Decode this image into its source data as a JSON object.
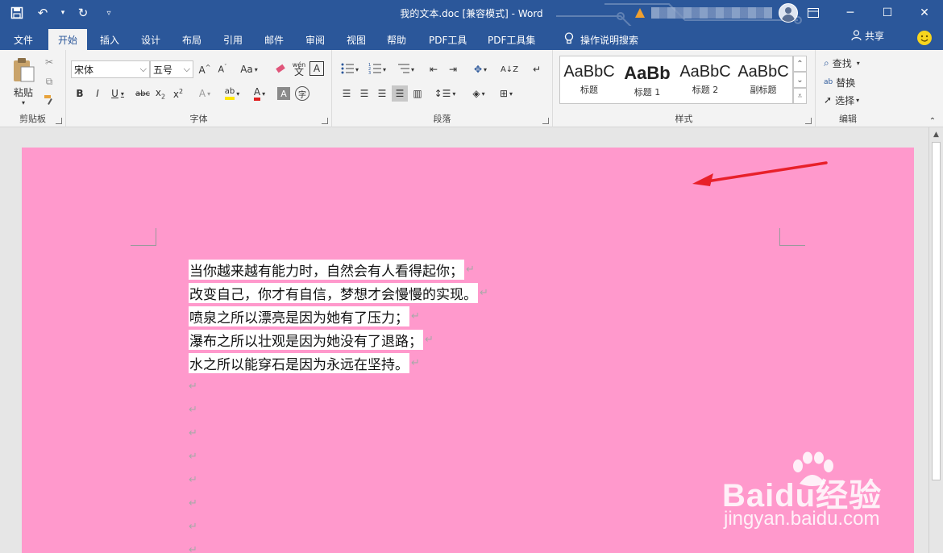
{
  "window": {
    "title": "我的文本.doc [兼容模式]  -  Word"
  },
  "tabs": [
    {
      "label": "文件"
    },
    {
      "label": "开始",
      "active": true
    },
    {
      "label": "插入"
    },
    {
      "label": "设计"
    },
    {
      "label": "布局"
    },
    {
      "label": "引用"
    },
    {
      "label": "邮件"
    },
    {
      "label": "审阅"
    },
    {
      "label": "视图"
    },
    {
      "label": "帮助"
    },
    {
      "label": "PDF工具"
    },
    {
      "label": "PDF工具集"
    }
  ],
  "tell_me": "操作说明搜索",
  "share_label": "共享",
  "ribbon": {
    "clipboard": {
      "label": "剪贴板",
      "paste": "粘贴"
    },
    "font": {
      "label": "字体",
      "font_name": "宋体",
      "font_size": "五号",
      "change_case": "Aa",
      "phonetic": "wén"
    },
    "paragraph": {
      "label": "段落"
    },
    "styles": {
      "label": "样式",
      "items": [
        {
          "preview": "AaBbC",
          "name": "标题"
        },
        {
          "preview": "AaBb",
          "name": "标题 1"
        },
        {
          "preview": "AaBbC",
          "name": "标题 2"
        },
        {
          "preview": "AaBbC",
          "name": "副标题"
        }
      ]
    },
    "editing": {
      "label": "编辑",
      "find": "查找",
      "replace": "替换",
      "select": "选择"
    }
  },
  "document": {
    "background_color": "#ff99cc",
    "lines": [
      "当你越来越有能力时，自然会有人看得起你；",
      "改变自己，你才有自信，梦想才会慢慢的实现。",
      "喷泉之所以漂亮是因为她有了压力；",
      "瀑布之所以壮观是因为她没有了退路；",
      "水之所以能穿石是因为永远在坚持。"
    ],
    "paragraph_mark": "↵",
    "empty_paragraphs": 8
  },
  "watermark": {
    "brand": "Baidu经验",
    "url": "jingyan.baidu.com"
  },
  "colors": {
    "word_blue": "#2b579a",
    "ribbon_bg": "#f3f3f3",
    "page_bg": "#ff99cc",
    "arrow": "#e8202a"
  }
}
